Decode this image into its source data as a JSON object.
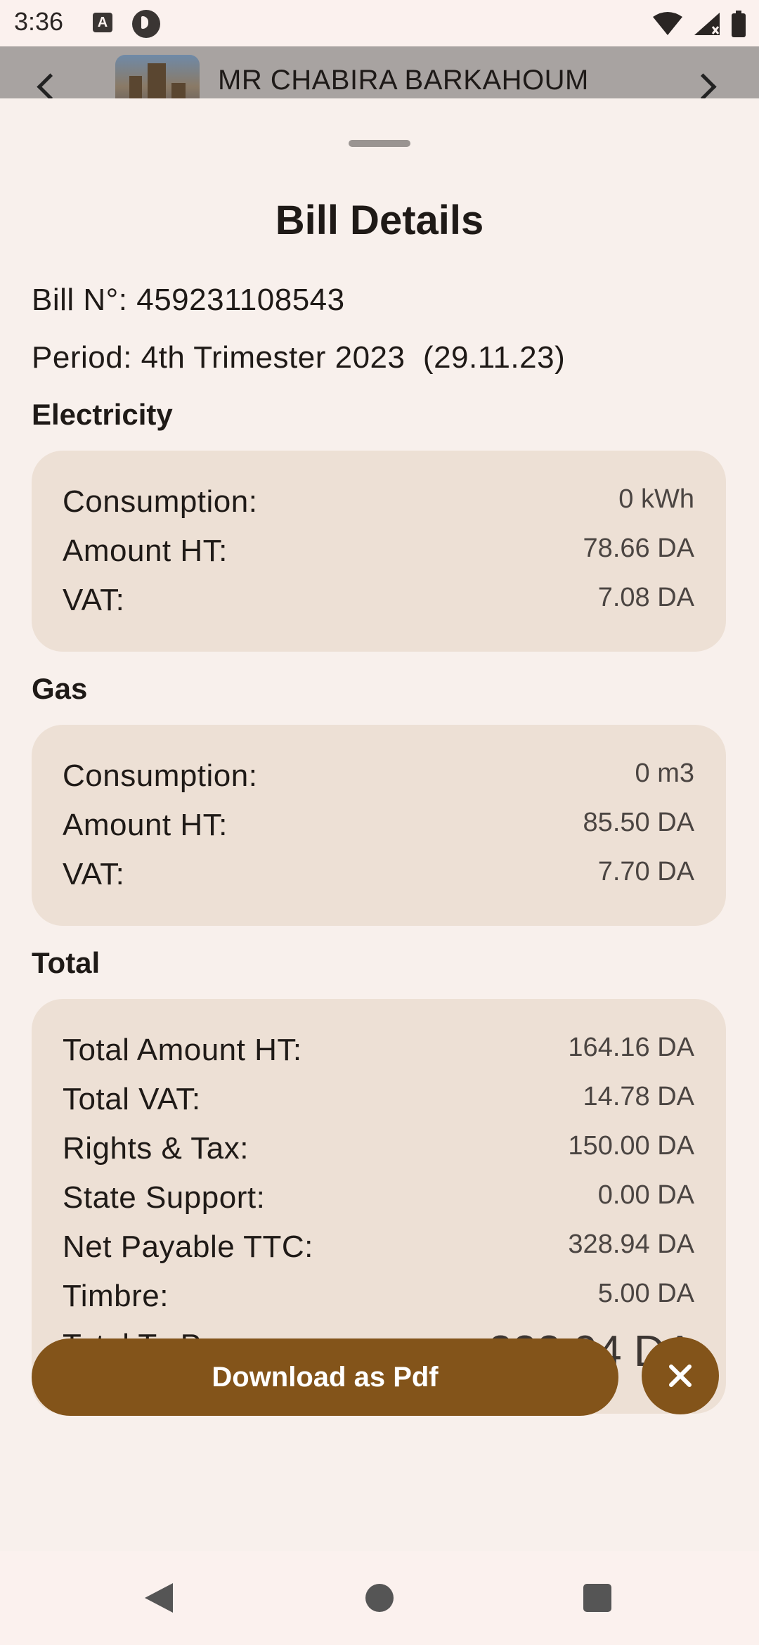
{
  "status_bar": {
    "time": "3:36",
    "icons": [
      "a-notification-icon",
      "p-notification-icon",
      "wifi-icon",
      "signal-icon",
      "battery-icon"
    ]
  },
  "background_header": {
    "name": "MR CHABIRA BARKAHOUM"
  },
  "sheet": {
    "title": "Bill Details",
    "bill_number": "Bill N°: 459231108543",
    "period": "Period: 4th Trimester 2023  (29.11.23)"
  },
  "electricity": {
    "label": "Electricity",
    "rows": [
      {
        "label": "Consumption:",
        "value": "0 kWh"
      },
      {
        "label": "Amount HT:",
        "value": "78.66 DA"
      },
      {
        "label": "VAT:",
        "value": "7.08 DA"
      }
    ]
  },
  "gas": {
    "label": "Gas",
    "rows": [
      {
        "label": "Consumption:",
        "value": "0 m3"
      },
      {
        "label": "Amount HT:",
        "value": "85.50 DA"
      },
      {
        "label": "VAT:",
        "value": "7.70 DA"
      }
    ]
  },
  "total": {
    "label": "Total",
    "rows": [
      {
        "label": "Total Amount HT:",
        "value": "164.16 DA"
      },
      {
        "label": "Total VAT:",
        "value": "14.78 DA"
      },
      {
        "label": "Rights & Tax:",
        "value": "150.00 DA"
      },
      {
        "label": "State Support:",
        "value": "0.00 DA"
      },
      {
        "label": "Net Payable TTC:",
        "value": "328.94 DA"
      },
      {
        "label": "Timbre:",
        "value": "5.00 DA"
      },
      {
        "label": "Total To Pay:",
        "value": "333.94 DA"
      }
    ]
  },
  "actions": {
    "download_label": "Download as Pdf",
    "close_icon": "close-icon"
  },
  "colors": {
    "background": "#f8f0ec",
    "card": "#ede0d5",
    "accent": "#83541a",
    "text": "#1f1a17"
  }
}
